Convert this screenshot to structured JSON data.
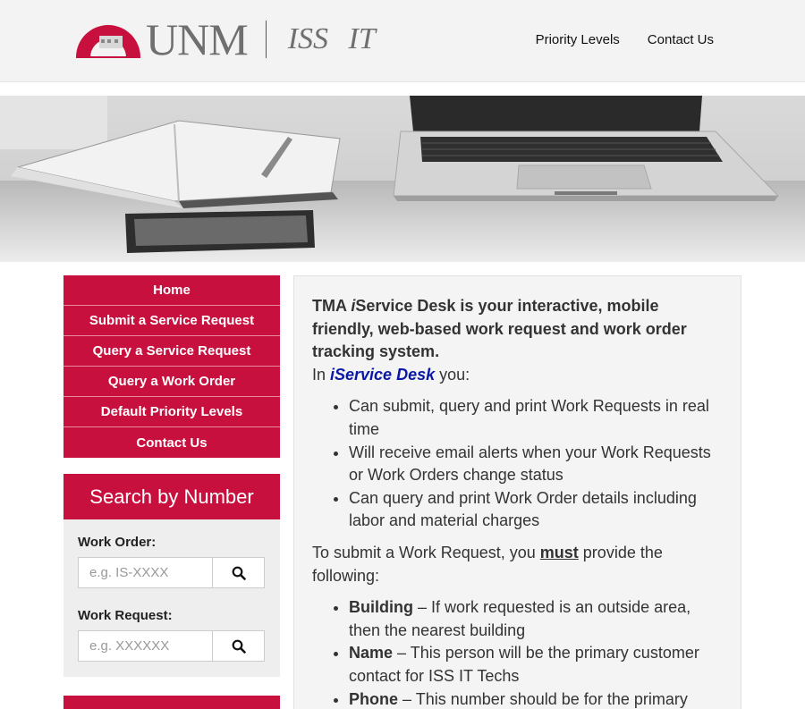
{
  "header": {
    "logo_text": "UNM",
    "dept_text": "ISS IT",
    "nav": [
      "Priority Levels",
      "Contact Us"
    ]
  },
  "sidenav": {
    "items": [
      "Home",
      "Submit a Service Request",
      "Query a Service Request",
      "Query a Work Order",
      "Default Priority Levels",
      "Contact Us"
    ]
  },
  "search": {
    "title": "Search by Number",
    "work_order_label": "Work Order:",
    "work_order_placeholder": "e.g. IS-XXXX",
    "work_request_label": "Work Request:",
    "work_request_placeholder": "e.g. XXXXXX"
  },
  "main": {
    "intro_prefix": "TMA ",
    "intro_i": "i",
    "intro_rest": "Service Desk is your interactive, mobile friendly, web-based work request and work order tracking system.",
    "in_prefix": "In ",
    "brand": "iService Desk",
    "in_suffix": " you:",
    "features": [
      "Can submit, query and print Work Requests in real time",
      "Will receive email alerts when your Work Requests or Work Orders change status",
      "Can query and print Work Order details including labor and material charges"
    ],
    "submit_prefix": "To submit a Work Request, you ",
    "submit_must": "must",
    "submit_suffix": " provide the following:",
    "requirements": [
      {
        "term": "Building",
        "desc": " – If work requested is an outside area, then the nearest building"
      },
      {
        "term": "Name",
        "desc": " – This person will be the primary customer contact for ISS IT Techs"
      },
      {
        "term": "Phone",
        "desc": " – This number should be for the primary"
      }
    ]
  },
  "colors": {
    "brand_red": "#c8103e",
    "link_blue": "#0a18a6"
  }
}
